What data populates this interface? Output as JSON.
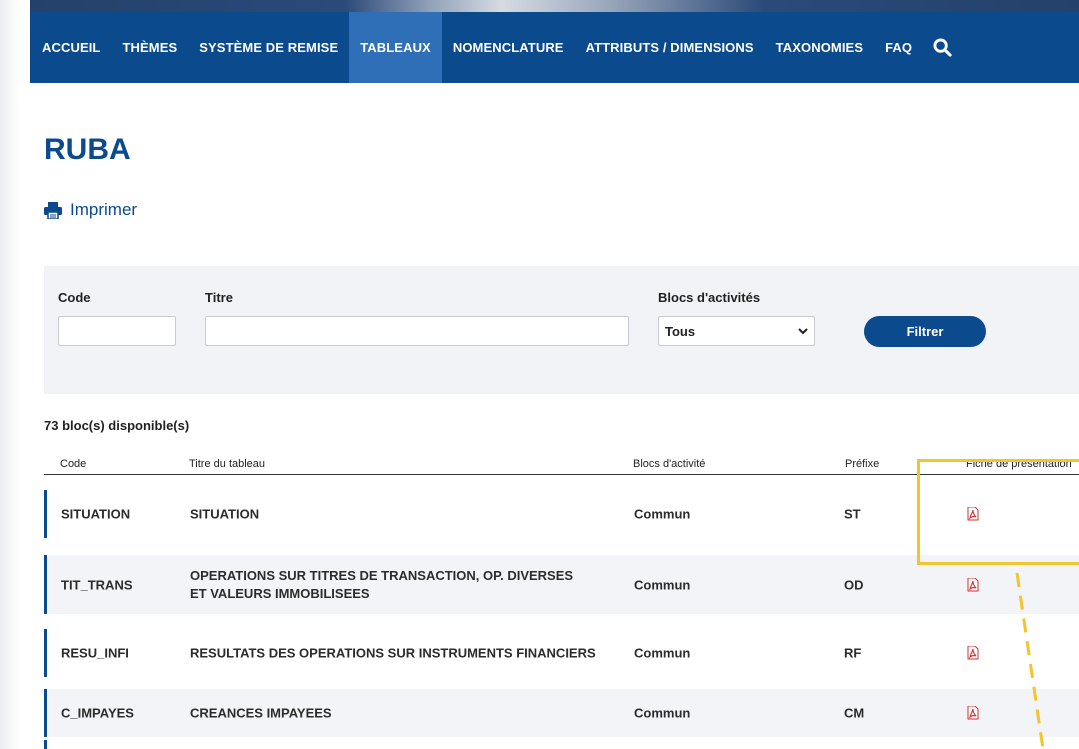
{
  "nav": {
    "items": [
      {
        "label": "ACCUEIL",
        "active": false
      },
      {
        "label": "THÈMES",
        "active": false
      },
      {
        "label": "SYSTÈME DE REMISE",
        "active": false
      },
      {
        "label": "TABLEAUX",
        "active": true
      },
      {
        "label": "NOMENCLATURE",
        "active": false
      },
      {
        "label": "ATTRIBUTS / DIMENSIONS",
        "active": false
      },
      {
        "label": "TAXONOMIES",
        "active": false
      },
      {
        "label": "FAQ",
        "active": false
      }
    ],
    "search_icon": "search-icon"
  },
  "page": {
    "title": "RUBA",
    "print_label": "Imprimer",
    "print_icon": "printer-icon"
  },
  "filter": {
    "code_label": "Code",
    "code_value": "",
    "title_label": "Titre",
    "title_value": "",
    "blocs_label": "Blocs d'activités",
    "blocs_selected": "Tous",
    "button_label": "Filtrer"
  },
  "table": {
    "count_text": "73 bloc(s) disponible(s)",
    "headers": {
      "code": "Code",
      "title": "Titre du tableau",
      "blocs": "Blocs d'activité",
      "prefix": "Préfixe",
      "fiche": "Fiche de présentation"
    },
    "rows": [
      {
        "code": "SITUATION",
        "title": "SITUATION",
        "blocs": "Commun",
        "prefix": "ST"
      },
      {
        "code": "TIT_TRANS",
        "title": "OPERATIONS SUR TITRES DE TRANSACTION, OP. DIVERSES ET VALEURS IMMOBILISEES",
        "blocs": "Commun",
        "prefix": "OD"
      },
      {
        "code": "RESU_INFI",
        "title": "RESULTATS DES OPERATIONS SUR INSTRUMENTS FINANCIERS",
        "blocs": "Commun",
        "prefix": "RF"
      },
      {
        "code": "C_IMPAYES",
        "title": "CREANCES IMPAYEES",
        "blocs": "Commun",
        "prefix": "CM"
      }
    ]
  },
  "colors": {
    "brand": "#0c4a8e",
    "nav_active": "#2e6fb8",
    "highlight": "#f2c42e",
    "pdf_icon": "#d32f2f"
  }
}
